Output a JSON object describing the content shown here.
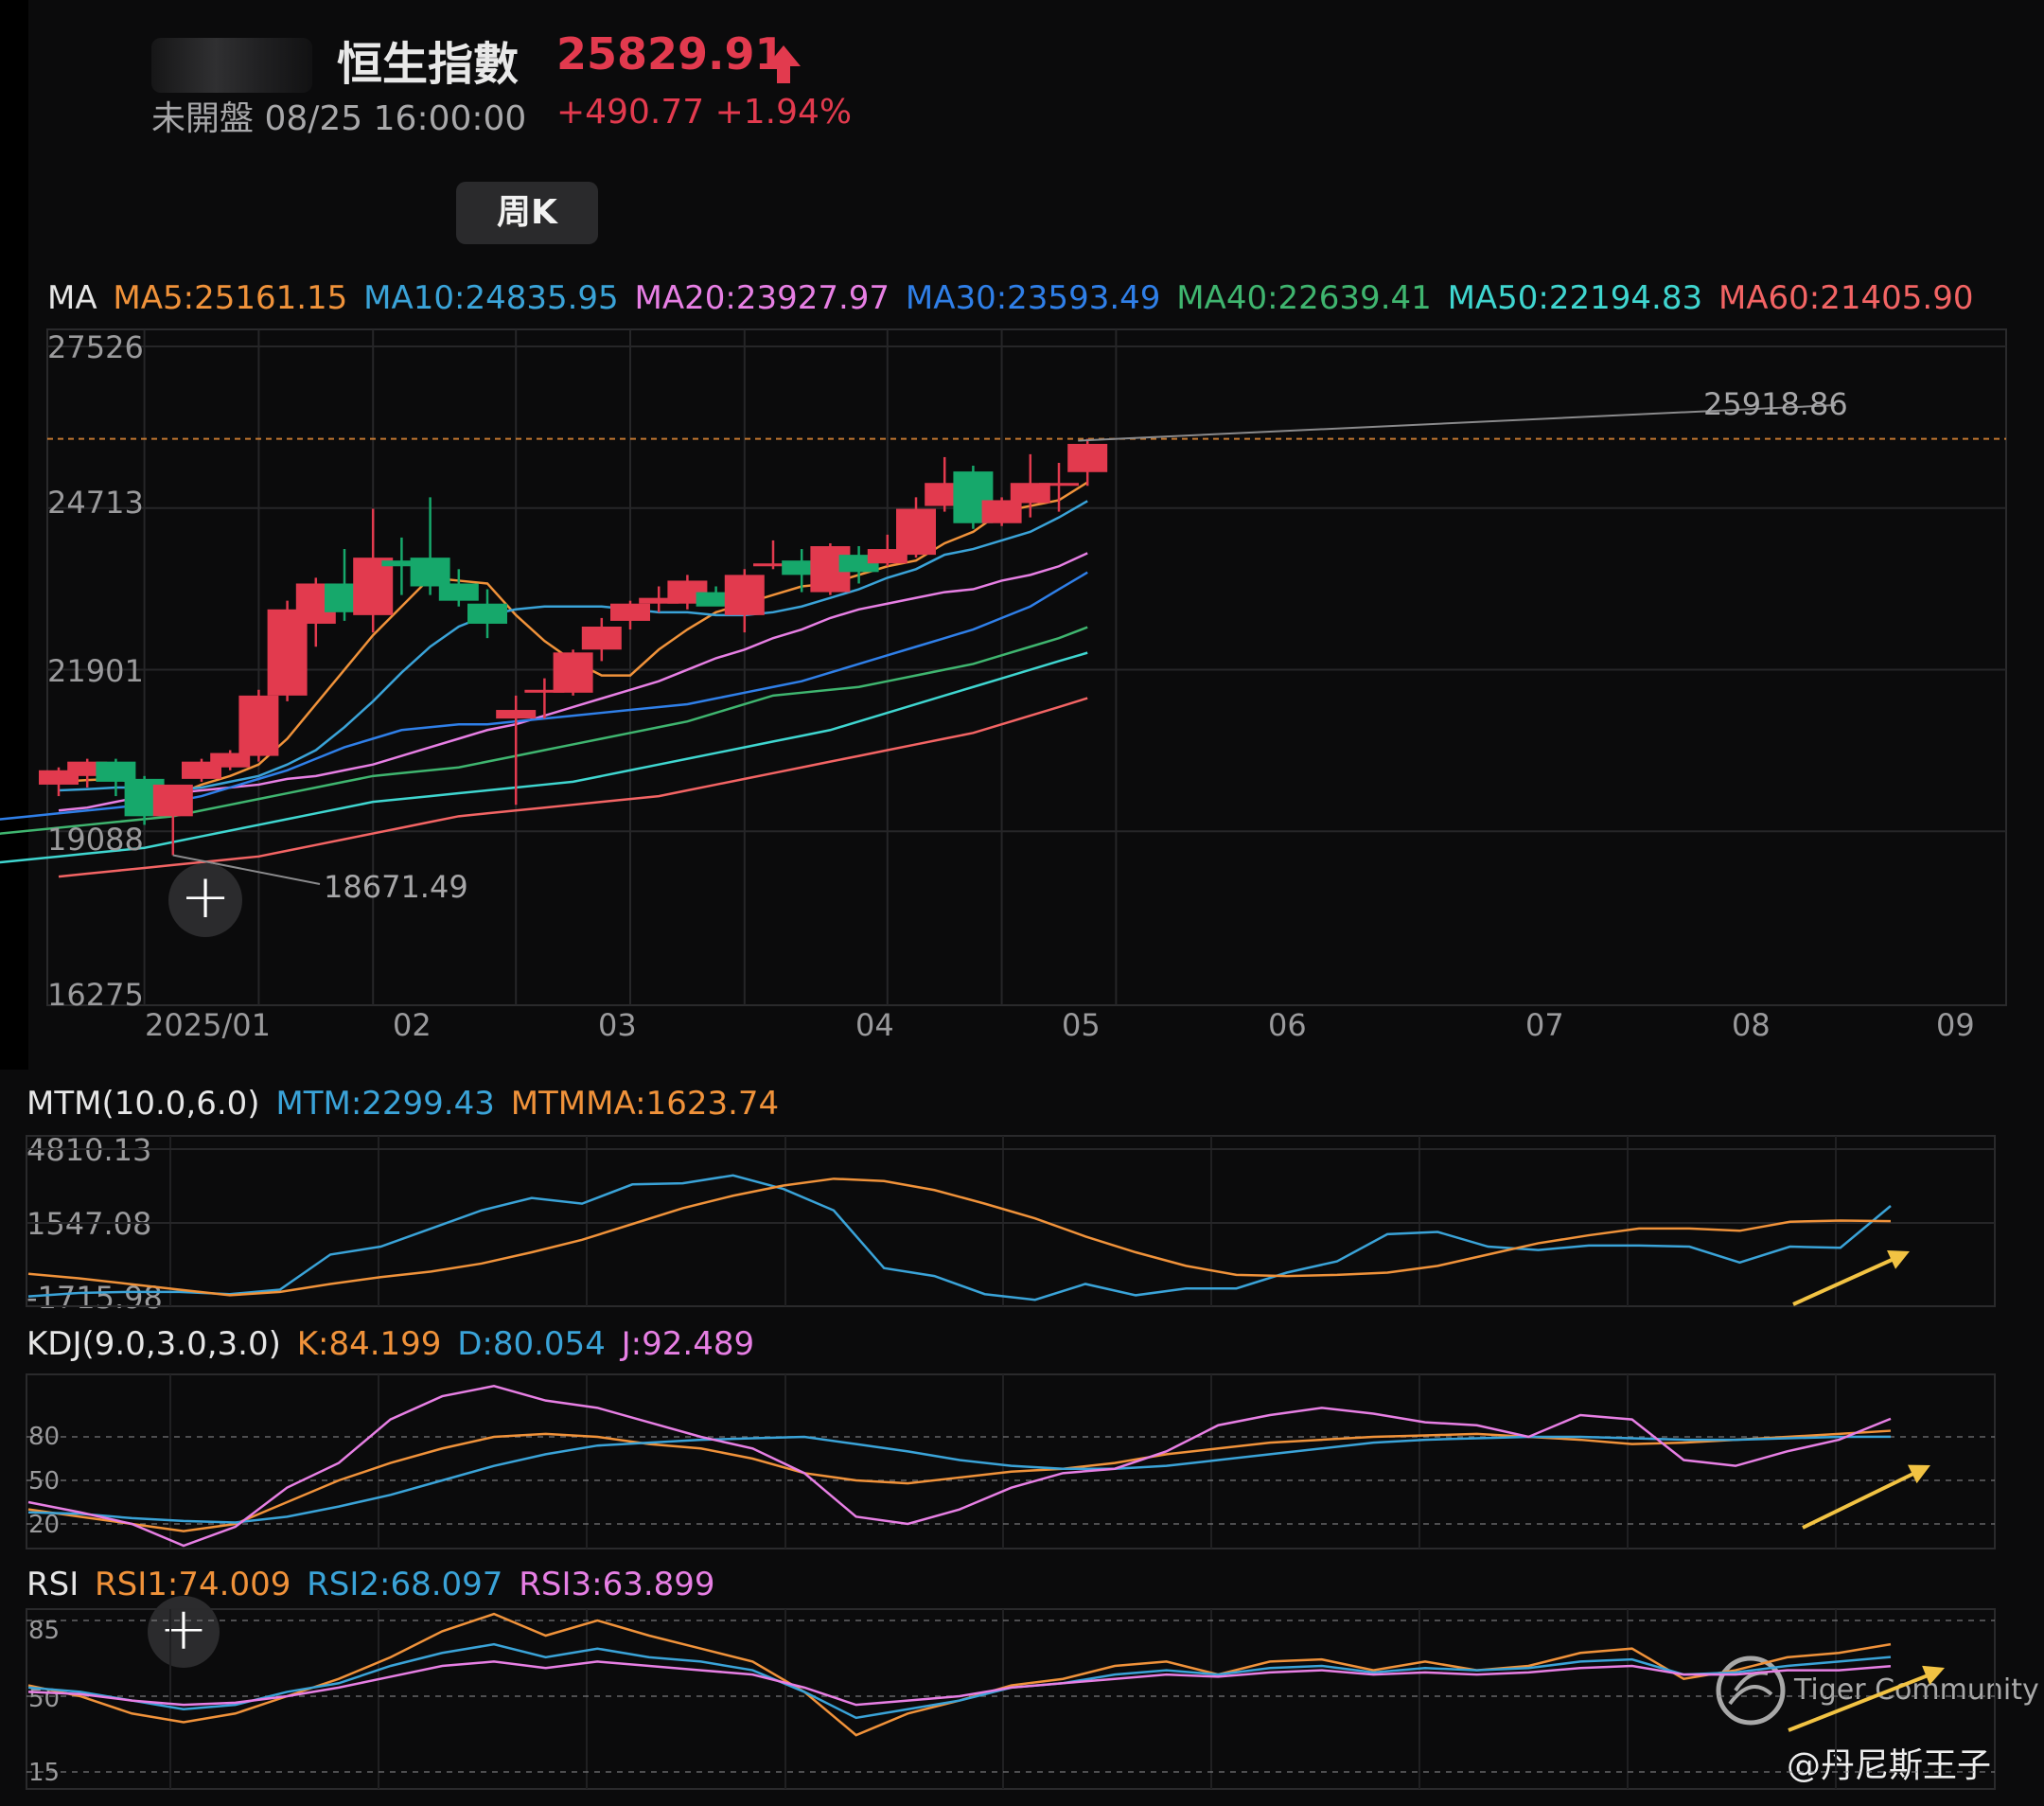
{
  "header": {
    "name": "恒生指數",
    "price": "25829.91",
    "status": "未開盤 08/25 16:00:00",
    "change": "+490.77 +1.94%",
    "period": "周K"
  },
  "colors": {
    "up": "#e23a4e",
    "down": "#16a86b",
    "ma5": "#f0923a",
    "ma10": "#3aa3d8",
    "ma20": "#e77fe4",
    "ma30": "#2f7fe8",
    "ma40": "#3fb56f",
    "ma50": "#3fd6d0",
    "ma60": "#f36464",
    "text": "#cfcfd1",
    "axis": "#9a9a9c",
    "arrow": "#f2c343"
  },
  "ma_legend": {
    "label": "MA",
    "ma5": "MA5:25161.15",
    "ma10": "MA10:24835.95",
    "ma20": "MA20:23927.97",
    "ma30": "MA30:23593.49",
    "ma40": "MA40:22639.41",
    "ma50": "MA50:22194.83",
    "ma60": "MA60:21405.90"
  },
  "mtm_legend": {
    "label": "MTM(10.0,6.0)",
    "mtm": "MTM:2299.43",
    "mtmma": "MTMMA:1623.74"
  },
  "kdj_legend": {
    "label": "KDJ(9.0,3.0,3.0)",
    "k": "K:84.199",
    "d": "D:80.054",
    "j": "J:92.489"
  },
  "rsi_legend": {
    "label": "RSI",
    "rsi1": "RSI1:74.009",
    "rsi2": "RSI2:68.097",
    "rsi3": "RSI3:63.899"
  },
  "watermark": {
    "brand": "Tiger Community",
    "author": "@丹尼斯王子"
  },
  "chart_data": [
    {
      "type": "candlestick",
      "ylim": [
        16275,
        27526
      ],
      "y_ticks": [
        "27526",
        "24713",
        "21901",
        "19088",
        "16275"
      ],
      "x_ticks": [
        "2025/01",
        "02",
        "03",
        "04",
        "05",
        "06",
        "07",
        "08",
        "09"
      ],
      "x_tick_weeks": [
        3,
        7,
        11,
        16,
        20,
        24,
        29,
        33,
        37
      ],
      "reference_line": {
        "value": 25918.86,
        "label": "25918.86",
        "style": "dashed"
      },
      "low_annotation": {
        "week": 4,
        "value": 18671.49,
        "label": "18671.49"
      },
      "ohlc": [
        [
          19900,
          20200,
          19700,
          20150
        ],
        [
          20050,
          20350,
          19850,
          20300
        ],
        [
          20300,
          20350,
          19700,
          19950
        ],
        [
          20000,
          20050,
          19200,
          19350
        ],
        [
          19350,
          19800,
          18671.49,
          19900
        ],
        [
          20000,
          20350,
          19950,
          20300
        ],
        [
          20200,
          20500,
          20150,
          20450
        ],
        [
          20400,
          21550,
          20300,
          21450
        ],
        [
          21450,
          23100,
          21350,
          22950
        ],
        [
          22700,
          23500,
          22300,
          23400
        ],
        [
          23400,
          24000,
          22750,
          22900
        ],
        [
          22850,
          24700,
          22550,
          23850
        ],
        [
          23800,
          24200,
          23200,
          23700
        ],
        [
          23850,
          24900,
          23200,
          23350
        ],
        [
          23400,
          23650,
          23000,
          23100
        ],
        [
          23050,
          23300,
          22450,
          22700
        ],
        [
          21050,
          21450,
          19550,
          21200
        ],
        [
          21500,
          21750,
          21050,
          21550
        ],
        [
          21500,
          22250,
          21450,
          22200
        ],
        [
          22250,
          22800,
          22050,
          22650
        ],
        [
          22750,
          23100,
          22600,
          23050
        ],
        [
          23050,
          23350,
          22900,
          23150
        ],
        [
          23050,
          23550,
          22950,
          23450
        ],
        [
          23250,
          23350,
          23050,
          23000
        ],
        [
          22850,
          23650,
          22550,
          23550
        ],
        [
          23700,
          24150,
          23650,
          23750
        ],
        [
          23800,
          24000,
          23250,
          23550
        ],
        [
          23250,
          24100,
          23200,
          24050
        ],
        [
          23900,
          24050,
          23400,
          23600
        ],
        [
          23750,
          24250,
          23700,
          24000
        ],
        [
          23900,
          24900,
          23850,
          24700
        ],
        [
          24750,
          25600,
          24650,
          25150
        ],
        [
          25350,
          25450,
          24350,
          24450
        ],
        [
          24450,
          24900,
          24400,
          24850
        ],
        [
          24800,
          25650,
          24550,
          25150
        ],
        [
          25100,
          25500,
          24650,
          25150
        ],
        [
          25339,
          25918.86,
          25100,
          25829.91
        ]
      ],
      "series": [
        {
          "name": "MA5",
          "values": [
            19950,
            19980,
            20000,
            19900,
            19700,
            19900,
            20050,
            20250,
            20700,
            21300,
            21900,
            22500,
            23000,
            23500,
            23450,
            23400,
            22850,
            22400,
            22050,
            21800,
            21800,
            22250,
            22600,
            22900,
            23050,
            23200,
            23350,
            23400,
            23550,
            23700,
            23800,
            24100,
            24300,
            24650,
            24750,
            24850,
            25161.15
          ]
        },
        {
          "name": "MA10",
          "values": [
            19800,
            19820,
            19850,
            19850,
            19800,
            19850,
            19950,
            20050,
            20250,
            20500,
            20900,
            21350,
            21850,
            22300,
            22650,
            22850,
            22950,
            23000,
            23000,
            23000,
            22950,
            22900,
            22900,
            22850,
            22850,
            22900,
            23000,
            23150,
            23300,
            23500,
            23650,
            23900,
            24000,
            24150,
            24300,
            24550,
            24835.95
          ]
        },
        {
          "name": "MA20",
          "values": [
            19450,
            19500,
            19600,
            19700,
            19750,
            19800,
            19850,
            19900,
            20000,
            20050,
            20150,
            20250,
            20400,
            20550,
            20700,
            20850,
            20950,
            21100,
            21250,
            21400,
            21550,
            21700,
            21900,
            22100,
            22250,
            22450,
            22600,
            22800,
            22950,
            23050,
            23150,
            23250,
            23300,
            23450,
            23550,
            23700,
            23927.97
          ]
        },
        {
          "name": "MA30",
          "values": [
            19200,
            19250,
            19300,
            19350,
            19400,
            19450,
            19500,
            19550,
            19600,
            19700,
            19850,
            20000,
            20150,
            20350,
            20550,
            20700,
            20850,
            20900,
            20950,
            20950,
            21000,
            21050,
            21100,
            21150,
            21200,
            21250,
            21300,
            21400,
            21500,
            21600,
            21700,
            21850,
            22000,
            22150,
            22300,
            22450,
            22600,
            22800,
            23000,
            23300,
            23593.49
          ]
        },
        {
          "name": "MA40",
          "values": [
            18950,
            19000,
            19050,
            19100,
            19150,
            19200,
            19250,
            19300,
            19350,
            19450,
            19550,
            19650,
            19750,
            19850,
            19950,
            20050,
            20100,
            20150,
            20200,
            20300,
            20400,
            20500,
            20600,
            20700,
            20800,
            20900,
            21000,
            21150,
            21300,
            21450,
            21500,
            21550,
            21600,
            21700,
            21800,
            21900,
            22000,
            22150,
            22300,
            22450,
            22639.41
          ]
        },
        {
          "name": "MA50",
          "values": [
            18500,
            18550,
            18600,
            18650,
            18700,
            18750,
            18800,
            18900,
            19000,
            19100,
            19200,
            19300,
            19400,
            19500,
            19600,
            19650,
            19700,
            19750,
            19800,
            19850,
            19900,
            19950,
            20050,
            20150,
            20250,
            20350,
            20450,
            20550,
            20650,
            20750,
            20850,
            21000,
            21150,
            21300,
            21450,
            21600,
            21750,
            21900,
            22050,
            22194.83
          ]
        },
        {
          "name": "MA60",
          "values": [
            18300,
            18350,
            18400,
            18450,
            18500,
            18550,
            18600,
            18650,
            18750,
            18850,
            18950,
            19050,
            19150,
            19250,
            19350,
            19400,
            19450,
            19500,
            19550,
            19600,
            19650,
            19700,
            19800,
            19900,
            20000,
            20100,
            20200,
            20300,
            20400,
            20500,
            20600,
            20700,
            20800,
            20950,
            21100,
            21250,
            21405.9
          ]
        }
      ]
    },
    {
      "type": "line",
      "title": "MTM(10.0,6.0)",
      "ylim": [
        -1715.98,
        4810.13
      ],
      "y_ticks": [
        "4810.13",
        "1547.08",
        "-1715.98"
      ],
      "series": [
        {
          "name": "MTM",
          "values": [
            -1700,
            -1550,
            -1500,
            -1500,
            -1600,
            -1400,
            150,
            500,
            1300,
            2100,
            2650,
            2400,
            3250,
            3300,
            3650,
            3050,
            2100,
            -450,
            -800,
            -1600,
            -1850,
            -1150,
            -1650,
            -1350,
            -1350,
            -650,
            -150,
            1050,
            1150,
            500,
            350,
            550,
            550,
            500,
            -200,
            500,
            450,
            2299.43
          ]
        },
        {
          "name": "MTMMA",
          "values": [
            -700,
            -900,
            -1150,
            -1400,
            -1650,
            -1500,
            -1150,
            -850,
            -600,
            -250,
            250,
            800,
            1500,
            2200,
            2750,
            3200,
            3500,
            3400,
            3000,
            2400,
            1750,
            950,
            250,
            -350,
            -750,
            -800,
            -750,
            -650,
            -350,
            150,
            650,
            1000,
            1300,
            1300,
            1200,
            1600,
            1650,
            1623.74
          ]
        }
      ]
    },
    {
      "type": "line",
      "title": "KDJ(9.0,3.0,3.0)",
      "y_ticks": [
        "80",
        "50",
        "20"
      ],
      "series": [
        {
          "name": "K",
          "values": [
            30,
            25,
            20,
            15,
            20,
            35,
            50,
            62,
            72,
            80,
            82,
            80,
            75,
            72,
            65,
            55,
            50,
            48,
            52,
            56,
            58,
            62,
            68,
            72,
            76,
            78,
            80,
            81,
            82,
            80,
            78,
            75,
            76,
            78,
            80,
            82,
            84.199
          ]
        },
        {
          "name": "D",
          "values": [
            28,
            27,
            24,
            22,
            21,
            25,
            32,
            40,
            50,
            60,
            68,
            74,
            76,
            78,
            79,
            80,
            75,
            70,
            64,
            60,
            58,
            58,
            60,
            64,
            68,
            72,
            76,
            78,
            79,
            80,
            80,
            79,
            78,
            78,
            79,
            80,
            80.054
          ]
        },
        {
          "name": "J",
          "values": [
            35,
            28,
            20,
            5,
            18,
            45,
            62,
            92,
            108,
            115,
            105,
            100,
            90,
            80,
            72,
            55,
            25,
            20,
            30,
            45,
            55,
            58,
            70,
            88,
            95,
            100,
            96,
            90,
            88,
            80,
            95,
            92,
            64,
            60,
            70,
            78,
            92.489
          ]
        }
      ]
    },
    {
      "type": "line",
      "title": "RSI",
      "y_ticks": [
        "85",
        "50",
        "15"
      ],
      "series": [
        {
          "name": "RSI1",
          "values": [
            55,
            50,
            42,
            38,
            42,
            50,
            58,
            68,
            80,
            88,
            78,
            85,
            78,
            72,
            66,
            52,
            32,
            42,
            48,
            55,
            58,
            64,
            66,
            60,
            66,
            67,
            62,
            66,
            62,
            64,
            70,
            72,
            58,
            62,
            68,
            70,
            74.009
          ]
        },
        {
          "name": "RSI2",
          "values": [
            54,
            52,
            48,
            44,
            46,
            52,
            56,
            64,
            70,
            74,
            68,
            72,
            68,
            66,
            62,
            52,
            40,
            44,
            48,
            54,
            56,
            60,
            62,
            60,
            63,
            64,
            61,
            63,
            62,
            63,
            66,
            67,
            60,
            61,
            64,
            66,
            68.097
          ]
        },
        {
          "name": "RSI3",
          "values": [
            52,
            51,
            48,
            46,
            47,
            50,
            54,
            59,
            64,
            66,
            63,
            66,
            64,
            62,
            60,
            54,
            46,
            48,
            50,
            54,
            56,
            58,
            60,
            59,
            61,
            62,
            60,
            61,
            60,
            61,
            63,
            64,
            60,
            60,
            62,
            62,
            63.899
          ]
        }
      ]
    }
  ]
}
